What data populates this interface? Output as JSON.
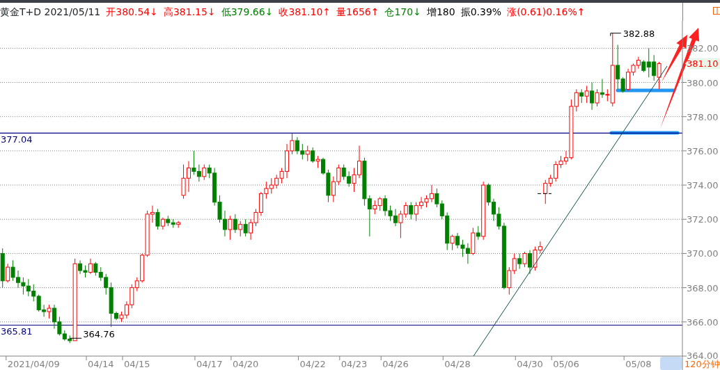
{
  "header": {
    "title": "黄金T+D",
    "date": "2021/05/11",
    "fields": [
      {
        "label": "开",
        "value": "380.54",
        "arrow": "↓",
        "color": "#ff0000"
      },
      {
        "label": "高",
        "value": "381.15",
        "arrow": "↓",
        "color": "#ff0000"
      },
      {
        "label": "低",
        "value": "379.66",
        "arrow": "↓",
        "color": "#008000"
      },
      {
        "label": "收",
        "value": "381.10",
        "arrow": "↑",
        "color": "#ff0000"
      },
      {
        "label": "量",
        "value": "1656",
        "arrow": "↑",
        "color": "#ff0000"
      },
      {
        "label": "仓",
        "value": "170",
        "arrow": "↓",
        "color": "#008000"
      },
      {
        "label": "增",
        "value": "180",
        "color": "#000000"
      },
      {
        "label": "振",
        "value": "0.39%",
        "color": "#000000"
      },
      {
        "label": "涨",
        "value": "(0.61)0.16%",
        "arrow": "↑",
        "color": "#ff0000"
      }
    ]
  },
  "chart": {
    "current_price": "381.10",
    "period": "120分钟",
    "chart_data": {
      "type": "candlestick",
      "ylim": [
        364,
        383.6
      ],
      "grid": true,
      "categories": [
        null,
        null,
        null,
        null,
        null,
        null,
        "2021/04/09",
        null,
        null,
        null,
        null,
        null,
        null,
        null,
        null,
        null,
        null,
        null,
        null,
        "04/14",
        null,
        null,
        null,
        null,
        null,
        null,
        "04/15",
        null,
        null,
        null,
        null,
        null,
        null,
        null,
        null,
        null,
        null,
        null,
        null,
        null,
        "04/17",
        null,
        null,
        null,
        null,
        null,
        null,
        "04/20",
        null,
        null,
        null,
        null,
        null,
        null,
        null,
        null,
        null,
        null,
        null,
        null,
        "04/22",
        null,
        null,
        null,
        null,
        null,
        null,
        null,
        "04/23",
        null,
        null,
        null,
        null,
        null,
        null,
        null,
        "04/26",
        null,
        null,
        null,
        null,
        null,
        null,
        null,
        null,
        null,
        null,
        null,
        "04/28",
        null,
        null,
        null,
        null,
        null,
        null,
        null,
        null,
        null,
        null,
        null,
        null,
        null,
        "04/30",
        null,
        null,
        null,
        null,
        null,
        null,
        "05/06",
        null,
        null,
        null,
        null,
        null,
        null,
        null,
        null,
        null,
        null,
        null,
        null,
        null,
        "05/08",
        null,
        null,
        null,
        null,
        null,
        null,
        null,
        null
      ],
      "yticks": [
        {
          "value": 364,
          "label": "364.00"
        },
        {
          "value": 366,
          "label": "366.00"
        },
        {
          "value": 368,
          "label": "368.00"
        },
        {
          "value": 370,
          "label": "370.00"
        },
        {
          "value": 372,
          "label": "372.00"
        },
        {
          "value": 374,
          "label": "374.00"
        },
        {
          "value": 376,
          "label": "376.00"
        },
        {
          "value": 378,
          "label": "378.00"
        },
        {
          "value": 380,
          "label": "380.00"
        },
        {
          "value": 382,
          "label": "382.00"
        }
      ],
      "ohlc": [
        [
          370,
          370.3,
          368,
          368.4
        ],
        [
          368.4,
          369.4,
          368.3,
          369.2
        ],
        [
          369.2,
          369.6,
          368.4,
          368.6
        ],
        [
          368.6,
          369,
          368,
          368.3
        ],
        [
          368.3,
          368.6,
          367.6,
          368.1
        ],
        [
          368.1,
          368.5,
          367.5,
          367.8
        ],
        [
          367.8,
          368.2,
          367.2,
          367.5
        ],
        [
          367.5,
          367.6,
          366.6,
          366.7
        ],
        [
          366.7,
          367,
          366.3,
          366.6
        ],
        [
          366.6,
          367,
          366.2,
          366.8
        ],
        [
          366.8,
          367,
          365.6,
          366
        ],
        [
          366,
          366.3,
          365.2,
          365.3
        ],
        [
          365.3,
          365.5,
          364.9,
          365
        ],
        [
          365,
          365.2,
          364.76,
          364.9
        ],
        [
          364.9,
          369.7,
          364.9,
          369.4
        ],
        [
          369.4,
          369.6,
          368.8,
          369
        ],
        [
          369,
          369.3,
          368.6,
          368.9
        ],
        [
          368.9,
          369.7,
          368.8,
          369.4
        ],
        [
          369.4,
          369.5,
          368.7,
          368.9
        ],
        [
          368.9,
          369.2,
          368.4,
          368.6
        ],
        [
          368.6,
          368.8,
          367.6,
          368
        ],
        [
          368,
          368.3,
          365.7,
          366.5
        ],
        [
          366.5,
          366.6,
          366.1,
          366.2
        ],
        [
          366.2,
          366.6,
          366,
          366.4
        ],
        [
          366.4,
          367.2,
          366.2,
          367
        ],
        [
          367,
          368.2,
          366.8,
          368
        ],
        [
          368,
          368.6,
          367.8,
          368.4
        ],
        [
          368.4,
          370,
          368.3,
          369.9
        ],
        [
          369.9,
          372.5,
          369.8,
          372.3
        ],
        [
          372.3,
          372.8,
          371.8,
          372.4
        ],
        [
          372.4,
          372.6,
          371.4,
          371.6
        ],
        [
          371.6,
          372.1,
          371.4,
          372
        ],
        [
          372,
          372.2,
          371.6,
          371.8
        ],
        [
          371.8,
          372,
          371.5,
          371.7
        ],
        [
          371.7,
          371.9,
          371.5,
          371.8
        ],
        [
          373.4,
          375.2,
          373.2,
          374.4
        ],
        [
          374.4,
          375.4,
          373.6,
          375
        ],
        [
          375,
          376,
          374.6,
          374.8
        ],
        [
          374.8,
          375.2,
          374.2,
          374.5
        ],
        [
          374.5,
          375.2,
          374.3,
          375
        ],
        [
          375,
          375.2,
          374.4,
          374.7
        ],
        [
          374.7,
          375,
          372.8,
          373
        ],
        [
          373,
          373.4,
          371.8,
          372
        ],
        [
          372,
          372.5,
          371,
          371.4
        ],
        [
          371.4,
          372.2,
          370.8,
          372
        ],
        [
          372,
          372.3,
          371.2,
          371.4
        ],
        [
          371.4,
          371.9,
          371,
          371.7
        ],
        [
          371.7,
          372,
          371,
          371.2
        ],
        [
          371.2,
          372,
          370.8,
          371.8
        ],
        [
          371.8,
          372.6,
          371.6,
          372.4
        ],
        [
          372.4,
          373.6,
          372.2,
          373.5
        ],
        [
          373.5,
          374.2,
          373.2,
          373.8
        ],
        [
          373.8,
          374.4,
          373.5,
          374
        ],
        [
          374,
          374.6,
          373.8,
          374.4
        ],
        [
          374.4,
          375,
          374.1,
          374.8
        ],
        [
          374.8,
          376.4,
          374.4,
          376
        ],
        [
          376,
          377,
          375.8,
          376.6
        ],
        [
          376.6,
          376.8,
          375.8,
          376
        ],
        [
          376,
          376.4,
          375.5,
          375.8
        ],
        [
          375.8,
          376.3,
          375.4,
          376
        ],
        [
          376,
          376.2,
          375.3,
          375.4
        ],
        [
          375.4,
          375.7,
          375,
          375.5
        ],
        [
          375.5,
          375.6,
          374.6,
          374.7
        ],
        [
          374.7,
          374.9,
          373,
          373.4
        ],
        [
          373.4,
          374.5,
          373,
          374.2
        ],
        [
          374.2,
          375.2,
          374,
          375
        ],
        [
          375,
          375.2,
          374.3,
          374.5
        ],
        [
          374.5,
          374.8,
          373.9,
          374.1
        ],
        [
          374.1,
          375,
          373.6,
          374.6
        ],
        [
          374.6,
          376.3,
          374.4,
          375.4
        ],
        [
          375.4,
          375.6,
          372.8,
          373.2
        ],
        [
          373.2,
          373.4,
          371,
          372.6
        ],
        [
          372.6,
          373.1,
          372.3,
          372.8
        ],
        [
          372.8,
          373.3,
          372.5,
          373.2
        ],
        [
          373.2,
          373.4,
          372.2,
          372.5
        ],
        [
          372.5,
          372.8,
          371.9,
          372.2
        ],
        [
          372.2,
          372.6,
          371.6,
          371.8
        ],
        [
          371.8,
          372.5,
          370.9,
          372.3
        ],
        [
          372.3,
          373,
          372.1,
          372.8
        ],
        [
          372.8,
          373,
          372,
          372.3
        ],
        [
          372.3,
          373,
          371.9,
          372.8
        ],
        [
          372.8,
          373.3,
          372.6,
          373
        ],
        [
          373,
          373.4,
          372.7,
          373.2
        ],
        [
          373.2,
          374,
          373,
          373.5
        ],
        [
          373.5,
          373.8,
          372.7,
          372.9
        ],
        [
          372.9,
          373.1,
          372,
          372.2
        ],
        [
          372.2,
          372.4,
          370.2,
          370.6
        ],
        [
          370.6,
          371.1,
          370.2,
          371
        ],
        [
          371,
          371.2,
          370.3,
          370.5
        ],
        [
          370.5,
          370.8,
          369.8,
          370.3
        ],
        [
          370.3,
          370.6,
          369.4,
          370
        ],
        [
          370,
          371.5,
          369.9,
          371.2
        ],
        [
          371.2,
          371.6,
          370.8,
          371
        ],
        [
          371,
          374.2,
          370.8,
          374
        ],
        [
          374,
          374.1,
          372.8,
          373
        ],
        [
          373,
          373.2,
          371.9,
          372.3
        ],
        [
          372.3,
          372.7,
          371.4,
          371.6
        ],
        [
          371.6,
          371.8,
          367.9,
          368
        ],
        [
          368,
          369.2,
          367.6,
          369
        ],
        [
          369,
          370,
          368.8,
          369.7
        ],
        [
          369.7,
          370,
          369.1,
          369.4
        ],
        [
          369.4,
          370.1,
          369.2,
          370
        ],
        [
          370,
          370.2,
          368.8,
          369.2
        ],
        [
          369.2,
          370.4,
          369,
          370.2
        ],
        [
          370.2,
          370.7,
          370,
          370.4
        ],
        [
          373.5,
          374.3,
          372.9,
          374.1
        ],
        [
          374.1,
          374.6,
          373.9,
          374.4
        ],
        [
          374.4,
          375.4,
          374.2,
          375.2
        ],
        [
          375.2,
          375.7,
          375,
          375.4
        ],
        [
          375.4,
          376,
          375.2,
          375.6
        ],
        [
          375.6,
          379,
          375.5,
          378.6
        ],
        [
          378.6,
          379.6,
          378.3,
          379.4
        ],
        [
          379.4,
          379.6,
          378.8,
          379.2
        ],
        [
          379.2,
          379.8,
          378.8,
          379.5
        ],
        [
          379.5,
          380,
          378.4,
          378.8
        ],
        [
          378.8,
          379.6,
          378.6,
          379.4
        ],
        [
          379.4,
          380.2,
          379.1,
          379.3
        ],
        [
          379.3,
          379.6,
          378.9,
          379.3
        ],
        [
          378.8,
          382.88,
          378.6,
          381
        ],
        [
          381,
          382.2,
          379.6,
          380.2
        ],
        [
          380.2,
          380.3,
          379.4,
          379.5
        ],
        [
          379.6,
          380.8,
          379.5,
          380.6
        ],
        [
          380.6,
          381.1,
          380.4,
          381
        ],
        [
          381,
          381.5,
          380.8,
          381.3
        ],
        [
          381.2,
          381.3,
          380.6,
          380.7
        ],
        [
          381.2,
          382,
          380.3,
          380.9
        ],
        [
          381.2,
          381.6,
          380.1,
          380.4
        ],
        [
          380.3,
          381.2,
          379.6,
          381.1
        ],
        null,
        null,
        null,
        null
      ],
      "ref_lines": [
        {
          "axis": "y",
          "value": 377.04,
          "label": "377.04"
        },
        {
          "axis": "y",
          "value": 365.81,
          "label": "365.81"
        }
      ],
      "annotations": [
        "382.88",
        "364.76"
      ]
    }
  }
}
